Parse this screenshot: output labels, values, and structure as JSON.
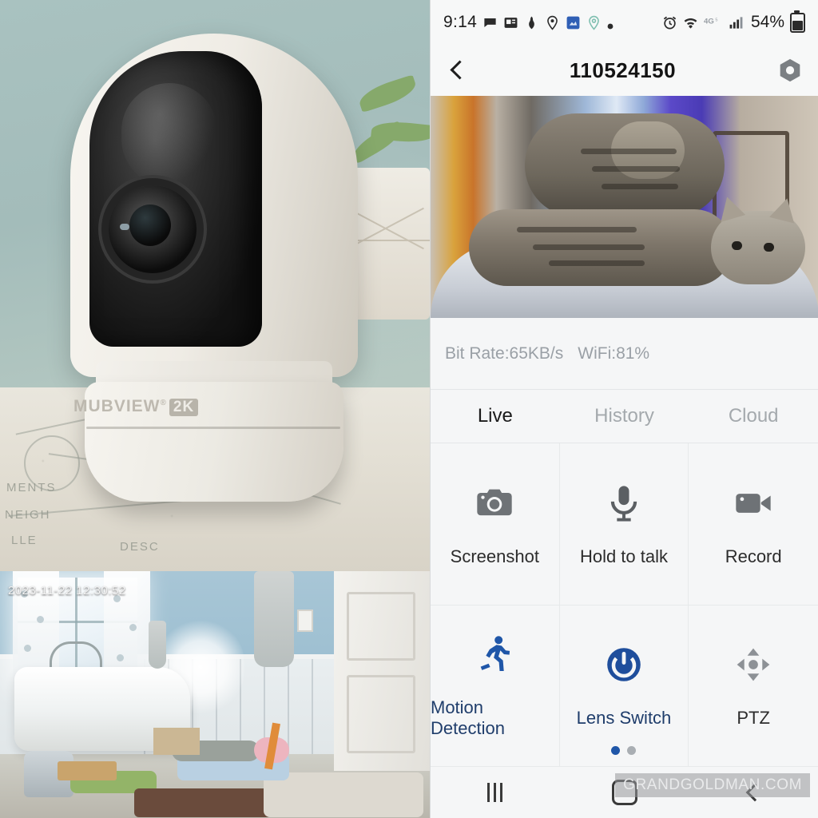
{
  "status_bar": {
    "time": "9:14",
    "battery_percent": "54%",
    "network": "4G",
    "left_icons": [
      "message-icon",
      "news-icon",
      "app-icon",
      "location-pin-icon",
      "calendar-app-icon",
      "location-pin-outline-icon",
      "dot-icon"
    ],
    "right_icons": [
      "alarm-icon",
      "wifi-icon",
      "4g-icon",
      "signal-bars-icon",
      "battery-icon"
    ]
  },
  "app_bar": {
    "back_icon": "chevron-left-icon",
    "title": "110524150",
    "settings_icon": "hex-gear-icon"
  },
  "video": {
    "alt": "Live camera view of two tabby cats resting in a pet bed"
  },
  "net_info": {
    "bit_rate": "Bit Rate:65KB/s",
    "wifi": "WiFi:81%"
  },
  "tabs": [
    {
      "label": "Live",
      "active": true
    },
    {
      "label": "History",
      "active": false
    },
    {
      "label": "Cloud",
      "active": false
    }
  ],
  "controls": [
    {
      "label": "Screenshot",
      "icon": "camera-icon",
      "icon_color": "#6e7276",
      "label_color": "#2c2c2c"
    },
    {
      "label": "Hold to talk",
      "icon": "microphone-icon",
      "icon_color": "#5b5f63",
      "label_color": "#2c2c2c"
    },
    {
      "label": "Record",
      "icon": "video-camera-icon",
      "icon_color": "#6e7276",
      "label_color": "#2c2c2c"
    },
    {
      "label": "Motion Detection",
      "icon": "running-person-icon",
      "icon_color": "#1f56a8",
      "label_color": "#1f3d6b"
    },
    {
      "label": "Lens Switch",
      "icon": "power-icon",
      "icon_color": "#1f4e9c",
      "label_color": "#1f3d6b"
    },
    {
      "label": "PTZ",
      "icon": "directional-pad-icon",
      "icon_color": "#8d9196",
      "label_color": "#2c2c2c"
    }
  ],
  "pagination": {
    "total": 2,
    "active_index": 0,
    "active_color": "#1f56a8",
    "inactive_color": "#a9aeb3"
  },
  "nav_bar": {
    "recents_icon": "recents-icon",
    "home_icon": "home-square-icon",
    "back_icon": "nav-back-icon",
    "watermark": "GRANDGOLDMAN.COM"
  },
  "left_photos": {
    "product": {
      "brand": "MUBVIEW",
      "brand_sup": "®",
      "badge": "2K",
      "alt": "White MUBVIEW 2K pan-tilt security camera on a patterned table"
    },
    "bathroom_feed": {
      "timestamp": "2023-11-22 12:30:52",
      "alt": "Camera feed of a bathroom with bathtub, towels and pet bedding"
    }
  }
}
